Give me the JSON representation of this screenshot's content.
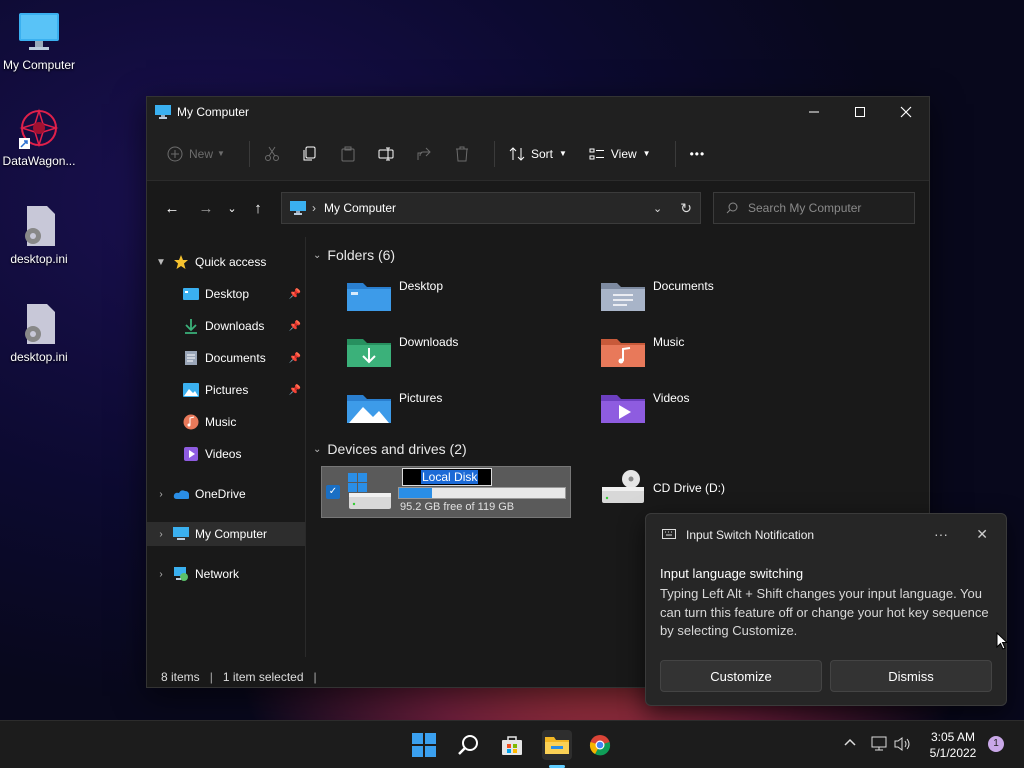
{
  "desktop": {
    "icons": [
      {
        "label": "My Computer"
      },
      {
        "label": "DataWagon..."
      },
      {
        "label": "desktop.ini"
      },
      {
        "label": "desktop.ini"
      }
    ]
  },
  "window": {
    "title": "My Computer",
    "toolbar": {
      "new_label": "New",
      "sort_label": "Sort",
      "view_label": "View",
      "more_label": "•••"
    },
    "address": {
      "path": "My Computer",
      "search_placeholder": "Search My Computer"
    },
    "sidebar": {
      "quick_access": "Quick access",
      "items": [
        {
          "label": "Desktop"
        },
        {
          "label": "Downloads"
        },
        {
          "label": "Documents"
        },
        {
          "label": "Pictures"
        },
        {
          "label": "Music"
        },
        {
          "label": "Videos"
        }
      ],
      "onedrive": "OneDrive",
      "my_computer": "My Computer",
      "network": "Network"
    },
    "content": {
      "folders_header": "Folders (6)",
      "folders": [
        {
          "name": "Desktop"
        },
        {
          "name": "Documents"
        },
        {
          "name": "Downloads"
        },
        {
          "name": "Music"
        },
        {
          "name": "Pictures"
        },
        {
          "name": "Videos"
        }
      ],
      "drives_header": "Devices and drives (2)",
      "local_disk": {
        "name": "Local Disk",
        "free_text": "95.2 GB free of 119 GB",
        "used_fraction": 0.2
      },
      "cd_drive": {
        "name": "CD Drive (D:)"
      }
    },
    "status": {
      "items": "8 items",
      "selected": "1 item selected"
    }
  },
  "notification": {
    "app": "Input Switch Notification",
    "heading": "Input language switching",
    "body": "Typing Left Alt + Shift changes your input language. You can turn this feature off or change your hot key sequence by selecting Customize.",
    "customize_label": "Customize",
    "dismiss_label": "Dismiss",
    "more": "···",
    "close": "✕"
  },
  "taskbar": {
    "time": "3:05 AM",
    "date": "5/1/2022",
    "badge_count": "1"
  },
  "colors": {
    "accent": "#1c6ad6",
    "folder_blue": "#3d9be9",
    "folder_green": "#3bb17a"
  }
}
